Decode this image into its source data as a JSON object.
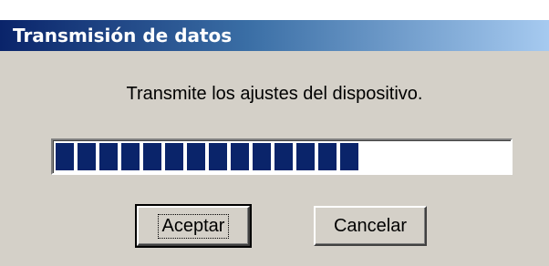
{
  "window": {
    "title": "Transmisión de datos"
  },
  "message": "Transmite los ajustes del dispositivo.",
  "progress": {
    "fraction": 0.71,
    "filled_blocks": 14,
    "color": "#0a246a"
  },
  "buttons": {
    "accept_label": "Aceptar",
    "cancel_label": "Cancelar"
  },
  "colors": {
    "titlebar_start": "#0a246a",
    "titlebar_end": "#a6caf0",
    "face": "#d4d0c8"
  }
}
